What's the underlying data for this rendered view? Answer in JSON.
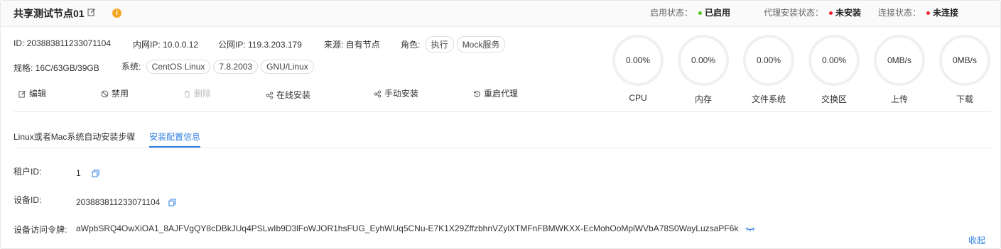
{
  "header": {
    "title": "共享测试节点01",
    "enable_status_label": "启用状态：",
    "enable_status_value": "已启用",
    "agent_status_label": "代理安装状态：",
    "agent_status_value": "未安装",
    "conn_status_label": "连接状态：",
    "conn_status_value": "未连接",
    "colors": {
      "ok": "#52c41a",
      "error": "#f5222d",
      "warn": "#f5a623",
      "accent": "#2d7de0"
    }
  },
  "info": {
    "id_label": "ID: ",
    "id_value": "203883811233071104",
    "inner_ip_label": "内网IP: ",
    "inner_ip_value": "10.0.0.12",
    "public_ip_label": "公网IP: ",
    "public_ip_value": "119.3.203.179",
    "source_label": "来源: ",
    "source_value": "自有节点",
    "role_label": "角色: ",
    "role_tags": [
      "执行",
      "Mock服务"
    ],
    "spec_label": "规格: ",
    "spec_value": "16C/63GB/39GB",
    "system_label": "系统: ",
    "system_tags": [
      "CentOS Linux",
      "7.8.2003",
      "GNU/Linux"
    ]
  },
  "actions": {
    "edit": "编辑",
    "disable": "禁用",
    "delete": "删除",
    "online_install": "在线安装",
    "manual_install": "手动安装",
    "restart_agent": "重启代理"
  },
  "metrics": [
    {
      "value": "0.00%",
      "label": "CPU"
    },
    {
      "value": "0.00%",
      "label": "内存"
    },
    {
      "value": "0.00%",
      "label": "文件系统"
    },
    {
      "value": "0.00%",
      "label": "交换区"
    },
    {
      "value": "0MB/s",
      "label": "上传"
    },
    {
      "value": "0MB/s",
      "label": "下载"
    }
  ],
  "tabs": [
    {
      "label": "Linux或者Mac系统自动安装步骤",
      "active": false
    },
    {
      "label": "安装配置信息",
      "active": true
    }
  ],
  "config": {
    "tenant_id_label": "租户ID:",
    "tenant_id_value": "1",
    "device_id_label": "设备ID:",
    "device_id_value": "203883811233071104",
    "token_label": "设备访问令牌:",
    "token_value": "aWpbSRQ4OwXiOA1_8AJFVgQY8cDBkJUq4PSLwIb9D3lFoWJOR1hsFUG_EyhWUq5CNu-E7K1X29ZffzbhnVZylXTMFnFBMWKXX-EcMohOoMplWVbA78S0WayLuzsaPF6k"
  },
  "footer": {
    "collapse": "收起"
  },
  "icons": [
    "edit-icon",
    "info-icon",
    "ban-icon",
    "trash-icon",
    "share-icon",
    "restart-icon",
    "copy-icon",
    "eye-closed-icon"
  ]
}
